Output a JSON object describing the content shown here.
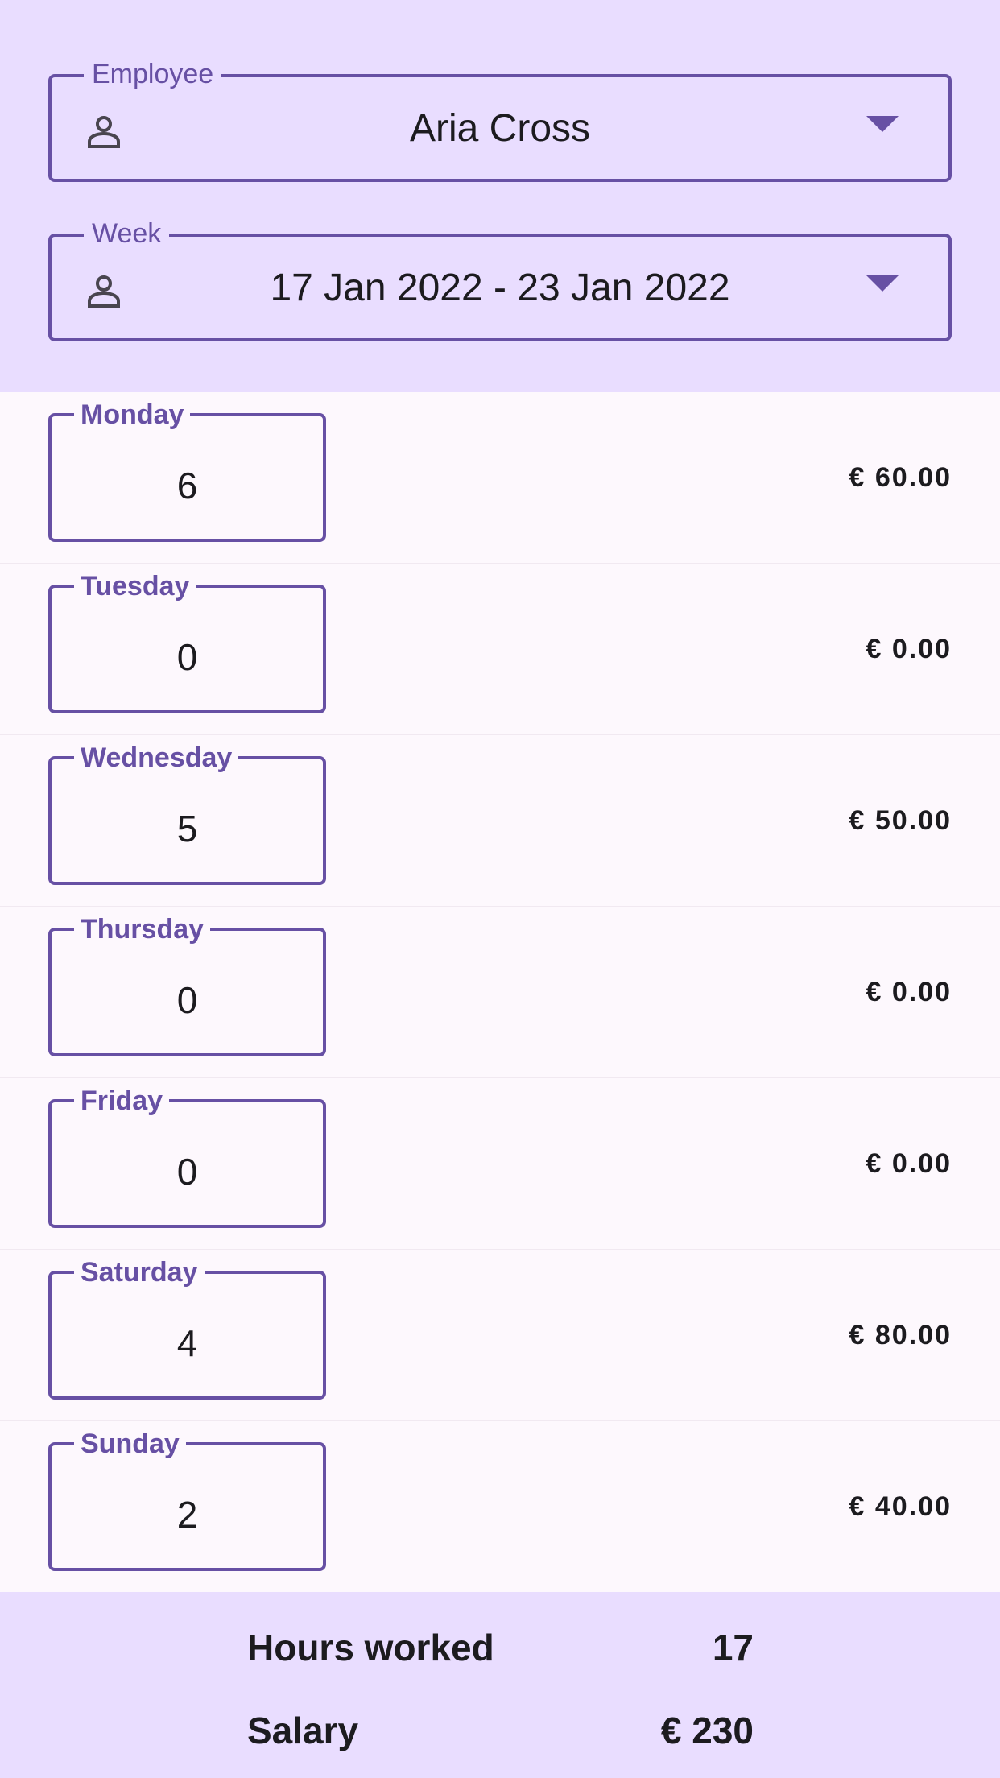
{
  "employee": {
    "label": "Employee",
    "value": "Aria Cross",
    "icon": "person-icon"
  },
  "week": {
    "label": "Week",
    "value": "17 Jan 2022 - 23 Jan 2022",
    "icon": "person-icon"
  },
  "days": [
    {
      "label": "Monday",
      "hours": "6",
      "pay": "€ 60.00"
    },
    {
      "label": "Tuesday",
      "hours": "0",
      "pay": "€ 0.00"
    },
    {
      "label": "Wednesday",
      "hours": "5",
      "pay": "€ 50.00"
    },
    {
      "label": "Thursday",
      "hours": "0",
      "pay": "€ 0.00"
    },
    {
      "label": "Friday",
      "hours": "0",
      "pay": "€ 0.00"
    },
    {
      "label": "Saturday",
      "hours": "4",
      "pay": "€ 80.00"
    },
    {
      "label": "Sunday",
      "hours": "2",
      "pay": "€ 40.00"
    }
  ],
  "summary": {
    "hours_label": "Hours worked",
    "hours_value": "17",
    "salary_label": "Salary",
    "salary_value": "€ 230"
  },
  "colors": {
    "accent": "#6750a4",
    "header_bg": "#e9ddff",
    "surface": "#fdf8fd"
  }
}
